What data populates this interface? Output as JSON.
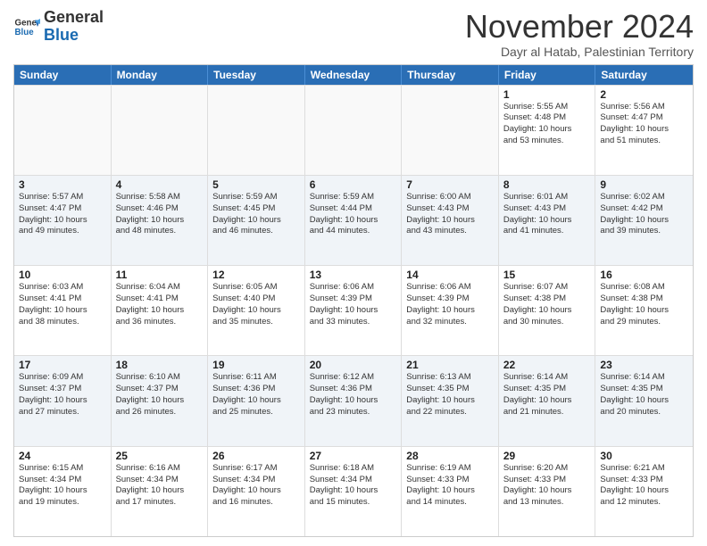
{
  "header": {
    "logo_general": "General",
    "logo_blue": "Blue",
    "month_title": "November 2024",
    "subtitle": "Dayr al Hatab, Palestinian Territory"
  },
  "weekdays": [
    "Sunday",
    "Monday",
    "Tuesday",
    "Wednesday",
    "Thursday",
    "Friday",
    "Saturday"
  ],
  "rows": [
    [
      {
        "day": "",
        "info": "",
        "empty": true
      },
      {
        "day": "",
        "info": "",
        "empty": true
      },
      {
        "day": "",
        "info": "",
        "empty": true
      },
      {
        "day": "",
        "info": "",
        "empty": true
      },
      {
        "day": "",
        "info": "",
        "empty": true
      },
      {
        "day": "1",
        "info": "Sunrise: 5:55 AM\nSunset: 4:48 PM\nDaylight: 10 hours\nand 53 minutes.",
        "empty": false
      },
      {
        "day": "2",
        "info": "Sunrise: 5:56 AM\nSunset: 4:47 PM\nDaylight: 10 hours\nand 51 minutes.",
        "empty": false
      }
    ],
    [
      {
        "day": "3",
        "info": "Sunrise: 5:57 AM\nSunset: 4:47 PM\nDaylight: 10 hours\nand 49 minutes.",
        "empty": false
      },
      {
        "day": "4",
        "info": "Sunrise: 5:58 AM\nSunset: 4:46 PM\nDaylight: 10 hours\nand 48 minutes.",
        "empty": false
      },
      {
        "day": "5",
        "info": "Sunrise: 5:59 AM\nSunset: 4:45 PM\nDaylight: 10 hours\nand 46 minutes.",
        "empty": false
      },
      {
        "day": "6",
        "info": "Sunrise: 5:59 AM\nSunset: 4:44 PM\nDaylight: 10 hours\nand 44 minutes.",
        "empty": false
      },
      {
        "day": "7",
        "info": "Sunrise: 6:00 AM\nSunset: 4:43 PM\nDaylight: 10 hours\nand 43 minutes.",
        "empty": false
      },
      {
        "day": "8",
        "info": "Sunrise: 6:01 AM\nSunset: 4:43 PM\nDaylight: 10 hours\nand 41 minutes.",
        "empty": false
      },
      {
        "day": "9",
        "info": "Sunrise: 6:02 AM\nSunset: 4:42 PM\nDaylight: 10 hours\nand 39 minutes.",
        "empty": false
      }
    ],
    [
      {
        "day": "10",
        "info": "Sunrise: 6:03 AM\nSunset: 4:41 PM\nDaylight: 10 hours\nand 38 minutes.",
        "empty": false
      },
      {
        "day": "11",
        "info": "Sunrise: 6:04 AM\nSunset: 4:41 PM\nDaylight: 10 hours\nand 36 minutes.",
        "empty": false
      },
      {
        "day": "12",
        "info": "Sunrise: 6:05 AM\nSunset: 4:40 PM\nDaylight: 10 hours\nand 35 minutes.",
        "empty": false
      },
      {
        "day": "13",
        "info": "Sunrise: 6:06 AM\nSunset: 4:39 PM\nDaylight: 10 hours\nand 33 minutes.",
        "empty": false
      },
      {
        "day": "14",
        "info": "Sunrise: 6:06 AM\nSunset: 4:39 PM\nDaylight: 10 hours\nand 32 minutes.",
        "empty": false
      },
      {
        "day": "15",
        "info": "Sunrise: 6:07 AM\nSunset: 4:38 PM\nDaylight: 10 hours\nand 30 minutes.",
        "empty": false
      },
      {
        "day": "16",
        "info": "Sunrise: 6:08 AM\nSunset: 4:38 PM\nDaylight: 10 hours\nand 29 minutes.",
        "empty": false
      }
    ],
    [
      {
        "day": "17",
        "info": "Sunrise: 6:09 AM\nSunset: 4:37 PM\nDaylight: 10 hours\nand 27 minutes.",
        "empty": false
      },
      {
        "day": "18",
        "info": "Sunrise: 6:10 AM\nSunset: 4:37 PM\nDaylight: 10 hours\nand 26 minutes.",
        "empty": false
      },
      {
        "day": "19",
        "info": "Sunrise: 6:11 AM\nSunset: 4:36 PM\nDaylight: 10 hours\nand 25 minutes.",
        "empty": false
      },
      {
        "day": "20",
        "info": "Sunrise: 6:12 AM\nSunset: 4:36 PM\nDaylight: 10 hours\nand 23 minutes.",
        "empty": false
      },
      {
        "day": "21",
        "info": "Sunrise: 6:13 AM\nSunset: 4:35 PM\nDaylight: 10 hours\nand 22 minutes.",
        "empty": false
      },
      {
        "day": "22",
        "info": "Sunrise: 6:14 AM\nSunset: 4:35 PM\nDaylight: 10 hours\nand 21 minutes.",
        "empty": false
      },
      {
        "day": "23",
        "info": "Sunrise: 6:14 AM\nSunset: 4:35 PM\nDaylight: 10 hours\nand 20 minutes.",
        "empty": false
      }
    ],
    [
      {
        "day": "24",
        "info": "Sunrise: 6:15 AM\nSunset: 4:34 PM\nDaylight: 10 hours\nand 19 minutes.",
        "empty": false
      },
      {
        "day": "25",
        "info": "Sunrise: 6:16 AM\nSunset: 4:34 PM\nDaylight: 10 hours\nand 17 minutes.",
        "empty": false
      },
      {
        "day": "26",
        "info": "Sunrise: 6:17 AM\nSunset: 4:34 PM\nDaylight: 10 hours\nand 16 minutes.",
        "empty": false
      },
      {
        "day": "27",
        "info": "Sunrise: 6:18 AM\nSunset: 4:34 PM\nDaylight: 10 hours\nand 15 minutes.",
        "empty": false
      },
      {
        "day": "28",
        "info": "Sunrise: 6:19 AM\nSunset: 4:33 PM\nDaylight: 10 hours\nand 14 minutes.",
        "empty": false
      },
      {
        "day": "29",
        "info": "Sunrise: 6:20 AM\nSunset: 4:33 PM\nDaylight: 10 hours\nand 13 minutes.",
        "empty": false
      },
      {
        "day": "30",
        "info": "Sunrise: 6:21 AM\nSunset: 4:33 PM\nDaylight: 10 hours\nand 12 minutes.",
        "empty": false
      }
    ]
  ]
}
